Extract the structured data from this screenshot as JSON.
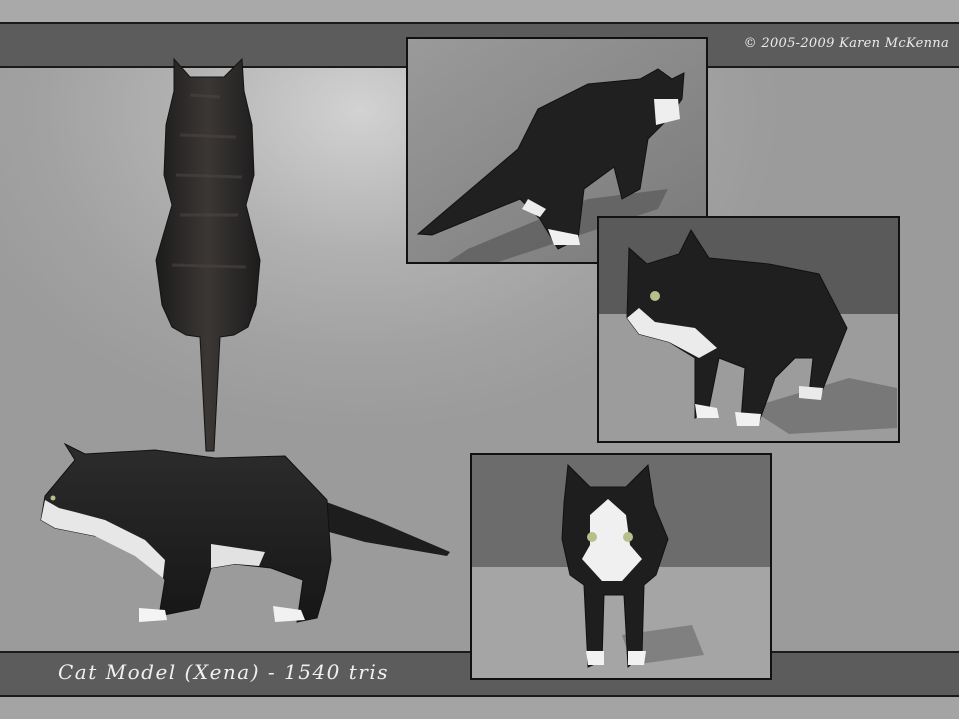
{
  "header": {
    "copyright": "© 2005-2009 Karen McKenna"
  },
  "footer": {
    "caption": "Cat Model (Xena) - 1540 tris"
  },
  "views": {
    "top": {
      "icon": "cat-top-view"
    },
    "side": {
      "icon": "cat-side-view"
    },
    "back": {
      "icon": "cat-back-three-quarter-render"
    },
    "front_three_quarter": {
      "icon": "cat-front-three-quarter-render"
    },
    "front": {
      "icon": "cat-front-render"
    }
  },
  "colors": {
    "band": "#5c5c5c",
    "background": "#a2a2a2",
    "fur_dark": "#1e1e1e",
    "fur_white": "#f2f2f2",
    "eyes": "#b7c08a"
  }
}
